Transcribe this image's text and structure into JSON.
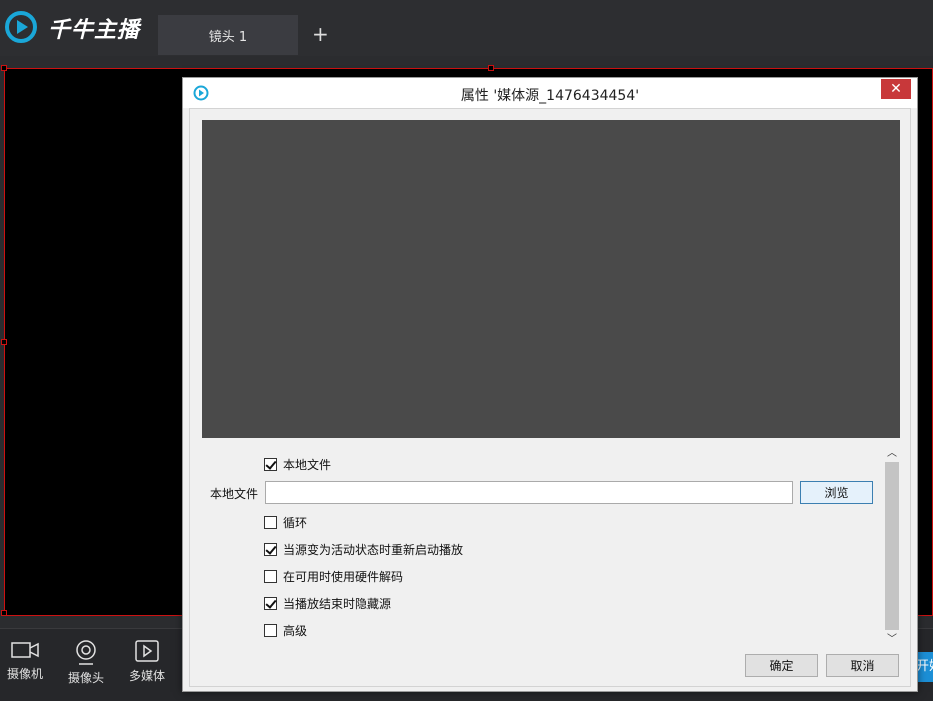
{
  "app": {
    "name": "千牛主播",
    "tabs": [
      {
        "label": "镜头 1"
      }
    ],
    "add_tab": "+"
  },
  "toolbar": {
    "items": [
      {
        "label": "摄像机",
        "icon": "video-camera-icon"
      },
      {
        "label": "摄像头",
        "icon": "webcam-icon"
      },
      {
        "label": "多媒体",
        "icon": "media-play-icon"
      }
    ],
    "live_button": "开始直播"
  },
  "dialog": {
    "title": "属性 '媒体源_1476434454'",
    "close": "✕",
    "local_file_checkbox": {
      "label": "本地文件",
      "checked": true
    },
    "local_file_field": {
      "label": "本地文件",
      "value": "",
      "placeholder": ""
    },
    "browse": "浏览",
    "options": [
      {
        "label": "循环",
        "checked": false
      },
      {
        "label": "当源变为活动状态时重新启动播放",
        "checked": true
      },
      {
        "label": "在可用时使用硬件解码",
        "checked": false
      },
      {
        "label": "当播放结束时隐藏源",
        "checked": true
      },
      {
        "label": "高级",
        "checked": false
      }
    ],
    "ok": "确定",
    "cancel": "取消"
  },
  "colors": {
    "accent": "#1c8fd6",
    "selection_border": "#cc1111",
    "close_button": "#c8383a",
    "preview_bg": "#4a4a4a"
  }
}
